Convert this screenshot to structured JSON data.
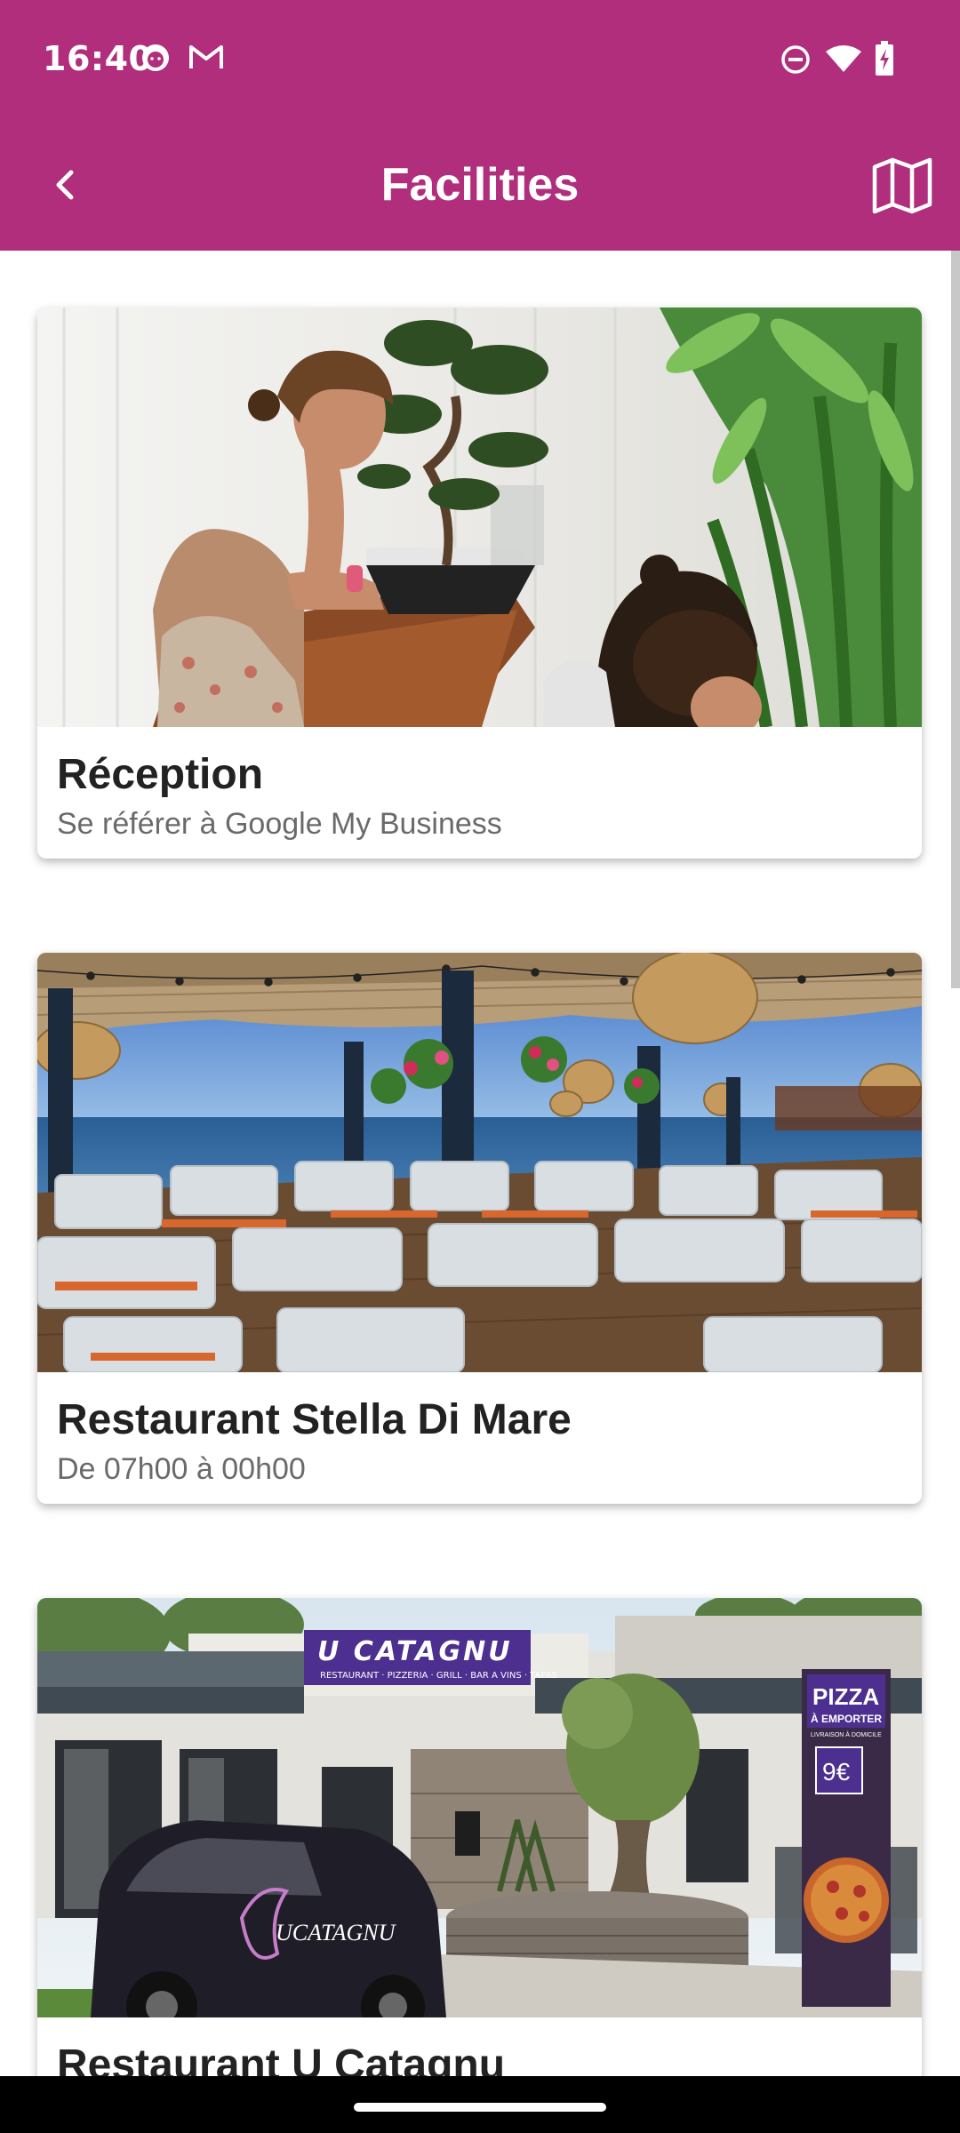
{
  "status_bar": {
    "time": "16:40",
    "left_icons": [
      "face-notification-icon",
      "gmail-icon"
    ],
    "right_icons": [
      "do-not-disturb-icon",
      "wifi-icon",
      "battery-charging-icon"
    ]
  },
  "app_bar": {
    "title": "Facilities",
    "back_icon": "chevron-left-icon",
    "map_icon": "map-icon",
    "color": "#b02e7c"
  },
  "facilities": [
    {
      "title": "Réception",
      "subtitle": "Se référer à Google My Business",
      "image": "reception-photo"
    },
    {
      "title": "Restaurant Stella Di Mare",
      "subtitle": "De 07h00 à 00h00",
      "image": "restaurant-terrace-photo"
    },
    {
      "title": "Restaurant U Catagnu",
      "subtitle": "",
      "image": "u-catagnu-photo",
      "image_text": {
        "sign": "U CATAGNU",
        "sign_sub": "RESTAURANT · PIZZERIA · GRILL · BAR A VINS · TAPAS",
        "banner_title": "PIZZA",
        "banner_line1": "À EMPORTER",
        "banner_line2": "LIVRAISON À DOMICILE",
        "price": "9€",
        "car_logo": "UCATAGNU"
      }
    }
  ]
}
